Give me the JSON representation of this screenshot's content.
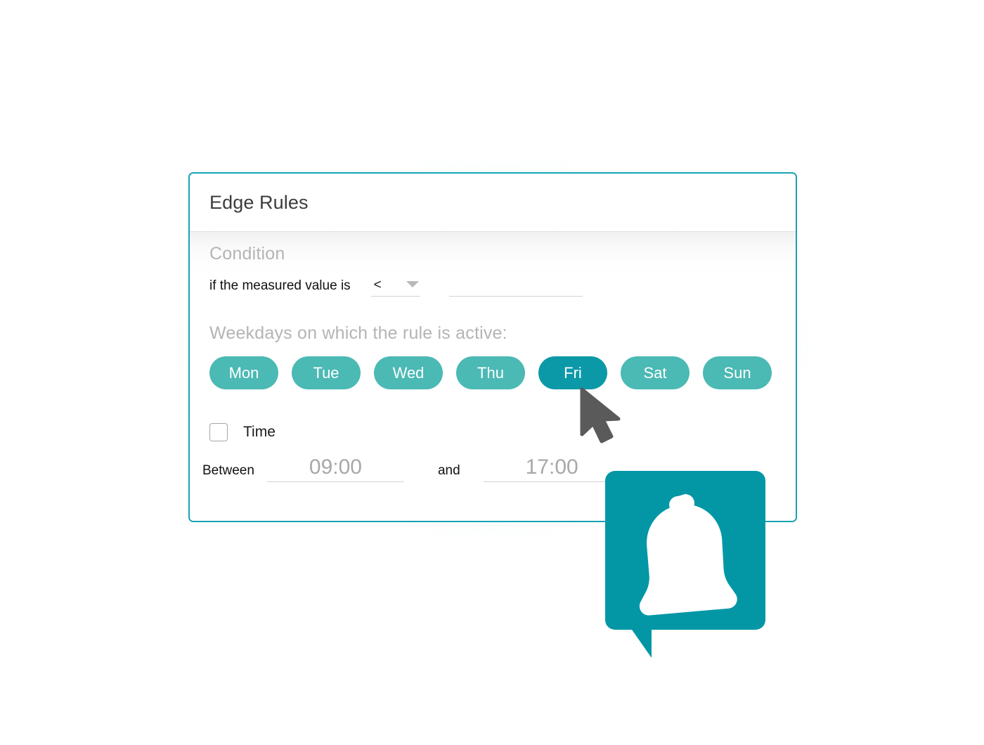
{
  "card": {
    "title": "Edge Rules",
    "accent_color": "#19a3b3",
    "glow_color": "#a8e4eb"
  },
  "condition": {
    "section_label": "Condition",
    "prefix_text": "if the measured value is",
    "operator": {
      "selected": "<",
      "options": [
        "<",
        ">",
        "=",
        "<=",
        ">="
      ]
    },
    "threshold": {
      "value": "",
      "placeholder": ""
    }
  },
  "weekdays": {
    "section_label": "Weekdays on which the rule is active:",
    "pill_color": "#4bb9b4",
    "pill_active_color": "#0b99a8",
    "days": [
      {
        "label": "Mon",
        "active": false
      },
      {
        "label": "Tue",
        "active": false
      },
      {
        "label": "Wed",
        "active": false
      },
      {
        "label": "Thu",
        "active": false
      },
      {
        "label": "Fri",
        "active": true
      },
      {
        "label": "Sat",
        "active": false
      },
      {
        "label": "Sun",
        "active": false
      }
    ]
  },
  "time": {
    "checkbox_label": "Time",
    "checked": false,
    "between_label": "Between",
    "and_label": "and",
    "start": {
      "value": "",
      "placeholder": "09:00"
    },
    "end": {
      "value": "",
      "placeholder": "17:00"
    }
  },
  "overlay": {
    "bell_bubble_color": "#0397a6",
    "bell_icon_color": "#ffffff",
    "cursor_color": "#5a5a5a",
    "bell_icon_name": "bell-icon",
    "cursor_icon_name": "mouse-pointer-icon"
  }
}
